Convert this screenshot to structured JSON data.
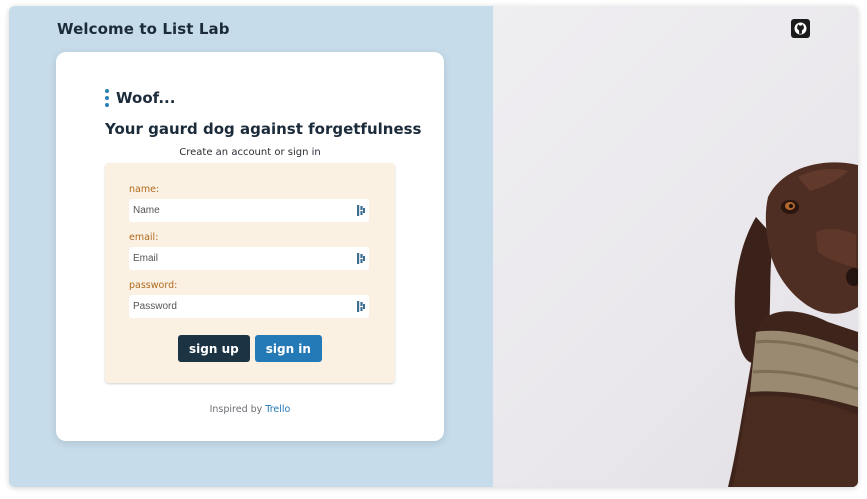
{
  "app": {
    "title": "Welcome to List Lab"
  },
  "brand": {
    "name": "Woof..."
  },
  "card": {
    "tagline": "Your gaurd dog against forgetfulness",
    "subtitle": "Create an account or sign in"
  },
  "form": {
    "name": {
      "label": "name:",
      "placeholder": "Name",
      "value": ""
    },
    "email": {
      "label": "email:",
      "placeholder": "Email",
      "value": ""
    },
    "password": {
      "label": "password:",
      "placeholder": "Password",
      "value": ""
    },
    "signup_label": "sign up",
    "signin_label": "sign in"
  },
  "footer": {
    "prefix": "Inspired by",
    "link_text": "Trello"
  },
  "icons": {
    "github": "github-icon",
    "field": "password-manager-icon"
  },
  "colors": {
    "left_bg": "#c6dcea",
    "form_bg": "#fbf1e3",
    "primary_dark": "#1c3344",
    "primary_blue": "#2479b7",
    "label_orange": "#b06a1e"
  }
}
